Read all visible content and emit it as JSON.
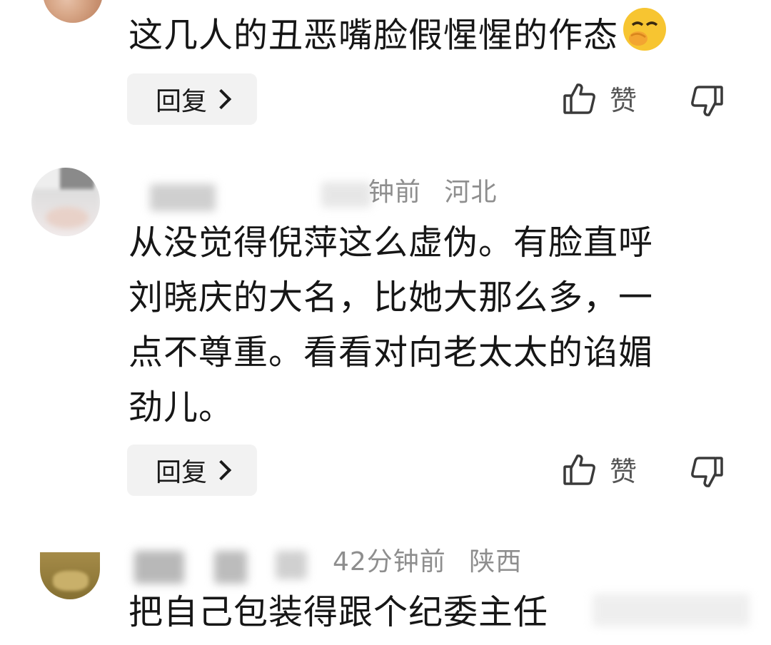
{
  "comments": [
    {
      "text": "这几人的丑恶嘴脸假惺惺的作态",
      "emoji": "😌",
      "reply_label": "回复",
      "like_label": "赞"
    },
    {
      "time": "钟前",
      "location": "河北",
      "lines": [
        "从没觉得倪萍这么虚伪。有脸直呼",
        "刘晓庆的大名，比她大那么多，一",
        "点不尊重。看看对向老太太的谄媚",
        "劲儿。"
      ],
      "reply_label": "回复",
      "like_label": "赞"
    },
    {
      "time": "42分钟前",
      "location": "陕西",
      "text": "把自己包装得跟个纪委主任"
    }
  ],
  "colors": {
    "reply_bg": "#f2f2f2",
    "meta_text": "#8e8e8e",
    "main_text": "#161616"
  },
  "icons": [
    "thumbs-up-icon",
    "thumbs-down-icon",
    "chevron-right-icon"
  ]
}
